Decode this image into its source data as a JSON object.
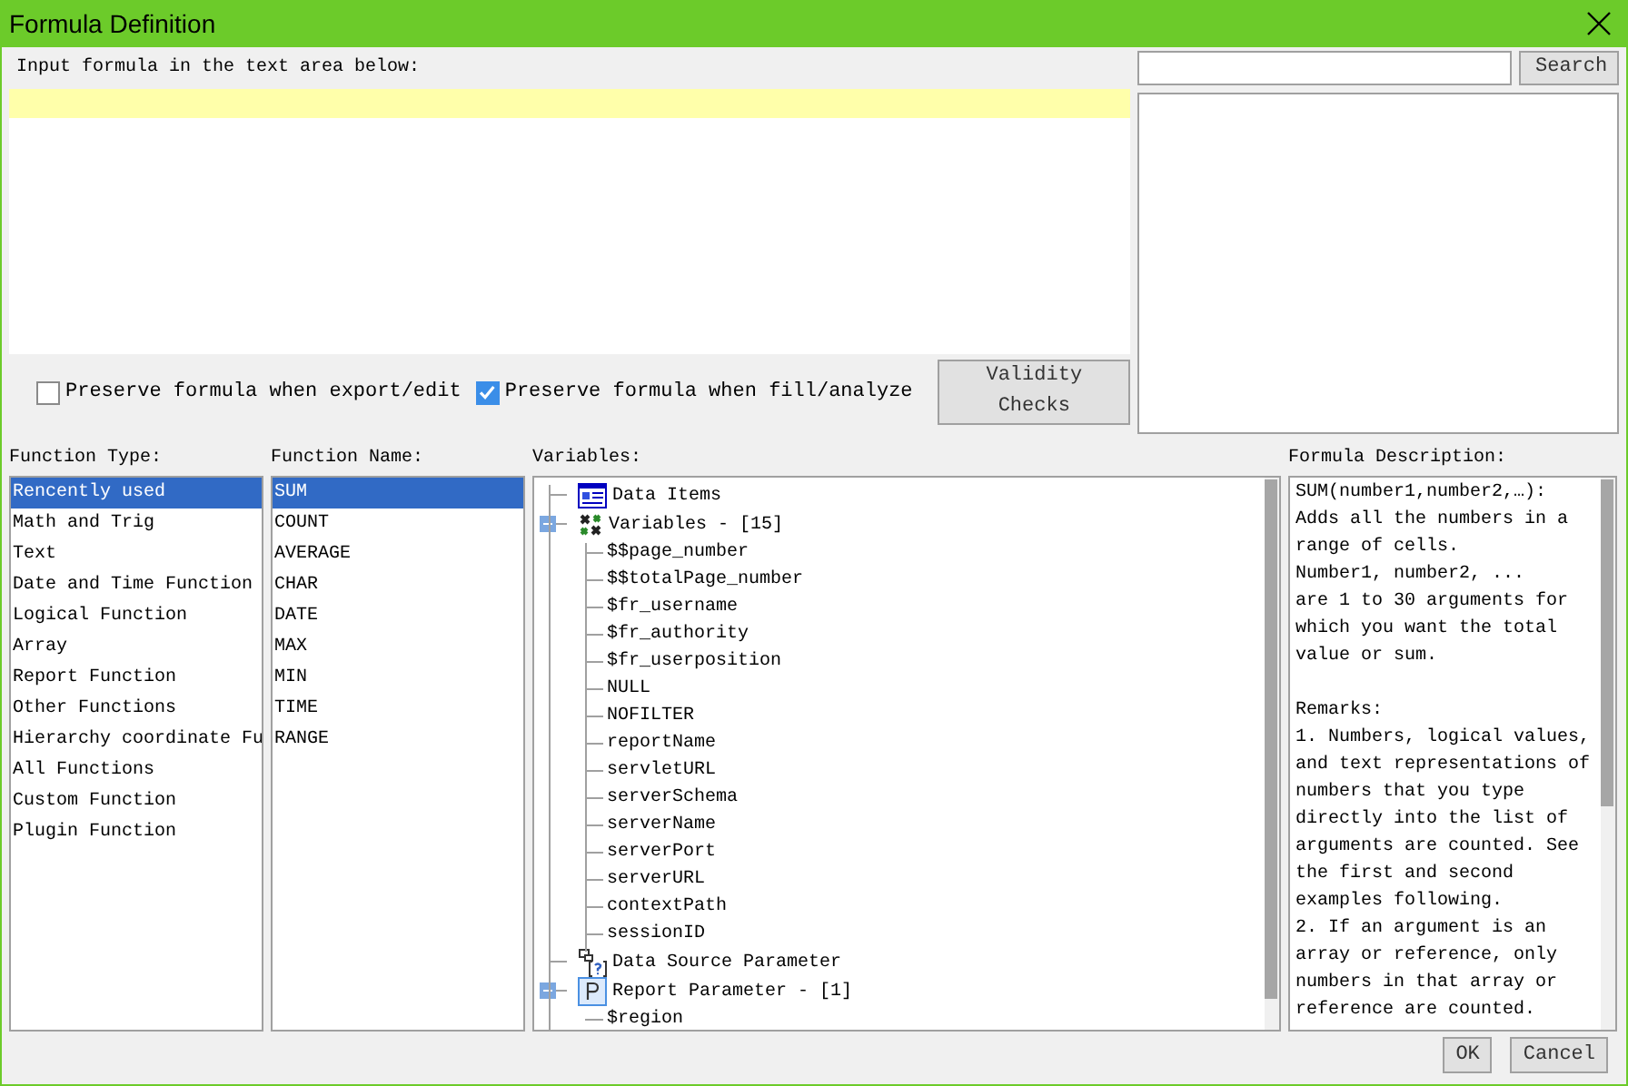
{
  "window": {
    "title": "Formula Definition"
  },
  "formula_label": "Input formula in the text area below:",
  "options": [
    {
      "label": "Preserve formula when export/edit",
      "checked": false
    },
    {
      "label": "Preserve formula when fill/analyze",
      "checked": true
    }
  ],
  "validity_button": "Validity Checks",
  "search_button": "Search",
  "function_type": {
    "label": "Function Type:",
    "items": [
      {
        "text": "Rencently used",
        "selected": true
      },
      {
        "text": "Math and Trig",
        "selected": false
      },
      {
        "text": "Text",
        "selected": false
      },
      {
        "text": "Date and Time Function",
        "selected": false
      },
      {
        "text": "Logical Function",
        "selected": false
      },
      {
        "text": "Array",
        "selected": false
      },
      {
        "text": "Report Function",
        "selected": false
      },
      {
        "text": "Other Functions",
        "selected": false
      },
      {
        "text": "Hierarchy coordinate Fu",
        "selected": false
      },
      {
        "text": "All Functions",
        "selected": false
      },
      {
        "text": "Custom Function",
        "selected": false
      },
      {
        "text": "Plugin Function",
        "selected": false
      }
    ]
  },
  "function_name": {
    "label": "Function Name:",
    "items": [
      {
        "text": "SUM",
        "selected": true
      },
      {
        "text": "COUNT",
        "selected": false
      },
      {
        "text": "AVERAGE",
        "selected": false
      },
      {
        "text": "CHAR",
        "selected": false
      },
      {
        "text": "DATE",
        "selected": false
      },
      {
        "text": "MAX",
        "selected": false
      },
      {
        "text": "MIN",
        "selected": false
      },
      {
        "text": "TIME",
        "selected": false
      },
      {
        "text": "RANGE",
        "selected": false
      }
    ]
  },
  "variables": {
    "label": "Variables:",
    "tree": [
      {
        "text": "Data Items",
        "kind": "data-items"
      },
      {
        "text": "Variables - [15]",
        "kind": "variables",
        "expanded": true,
        "children": [
          {
            "text": "$$page_number"
          },
          {
            "text": "$$totalPage_number"
          },
          {
            "text": "$fr_username"
          },
          {
            "text": "$fr_authority"
          },
          {
            "text": "$fr_userposition"
          },
          {
            "text": "NULL"
          },
          {
            "text": "NOFILTER"
          },
          {
            "text": "reportName"
          },
          {
            "text": "servletURL"
          },
          {
            "text": "serverSchema"
          },
          {
            "text": "serverName"
          },
          {
            "text": "serverPort"
          },
          {
            "text": "serverURL"
          },
          {
            "text": "contextPath"
          },
          {
            "text": "sessionID"
          }
        ]
      },
      {
        "text": "Data Source Parameter",
        "kind": "data-source"
      },
      {
        "text": "Report Parameter - [1]",
        "kind": "report-parameter",
        "expanded": true,
        "children": [
          {
            "text": "$region"
          }
        ]
      }
    ]
  },
  "description": {
    "label": "Formula Description:",
    "text": "SUM(number1,number2,…):\nAdds all the numbers in a range of cells.\nNumber1, number2, ...\nare 1 to 30 arguments for which you want the total value or sum.\n\nRemarks:\n1. Numbers, logical values, and text representations of numbers that you type directly into the list of arguments are counted. See the first and second examples following.\n2. If an argument is an array or reference, only numbers in that array or reference are counted."
  },
  "buttons": [
    {
      "label": "OK"
    },
    {
      "label": "Cancel"
    }
  ]
}
